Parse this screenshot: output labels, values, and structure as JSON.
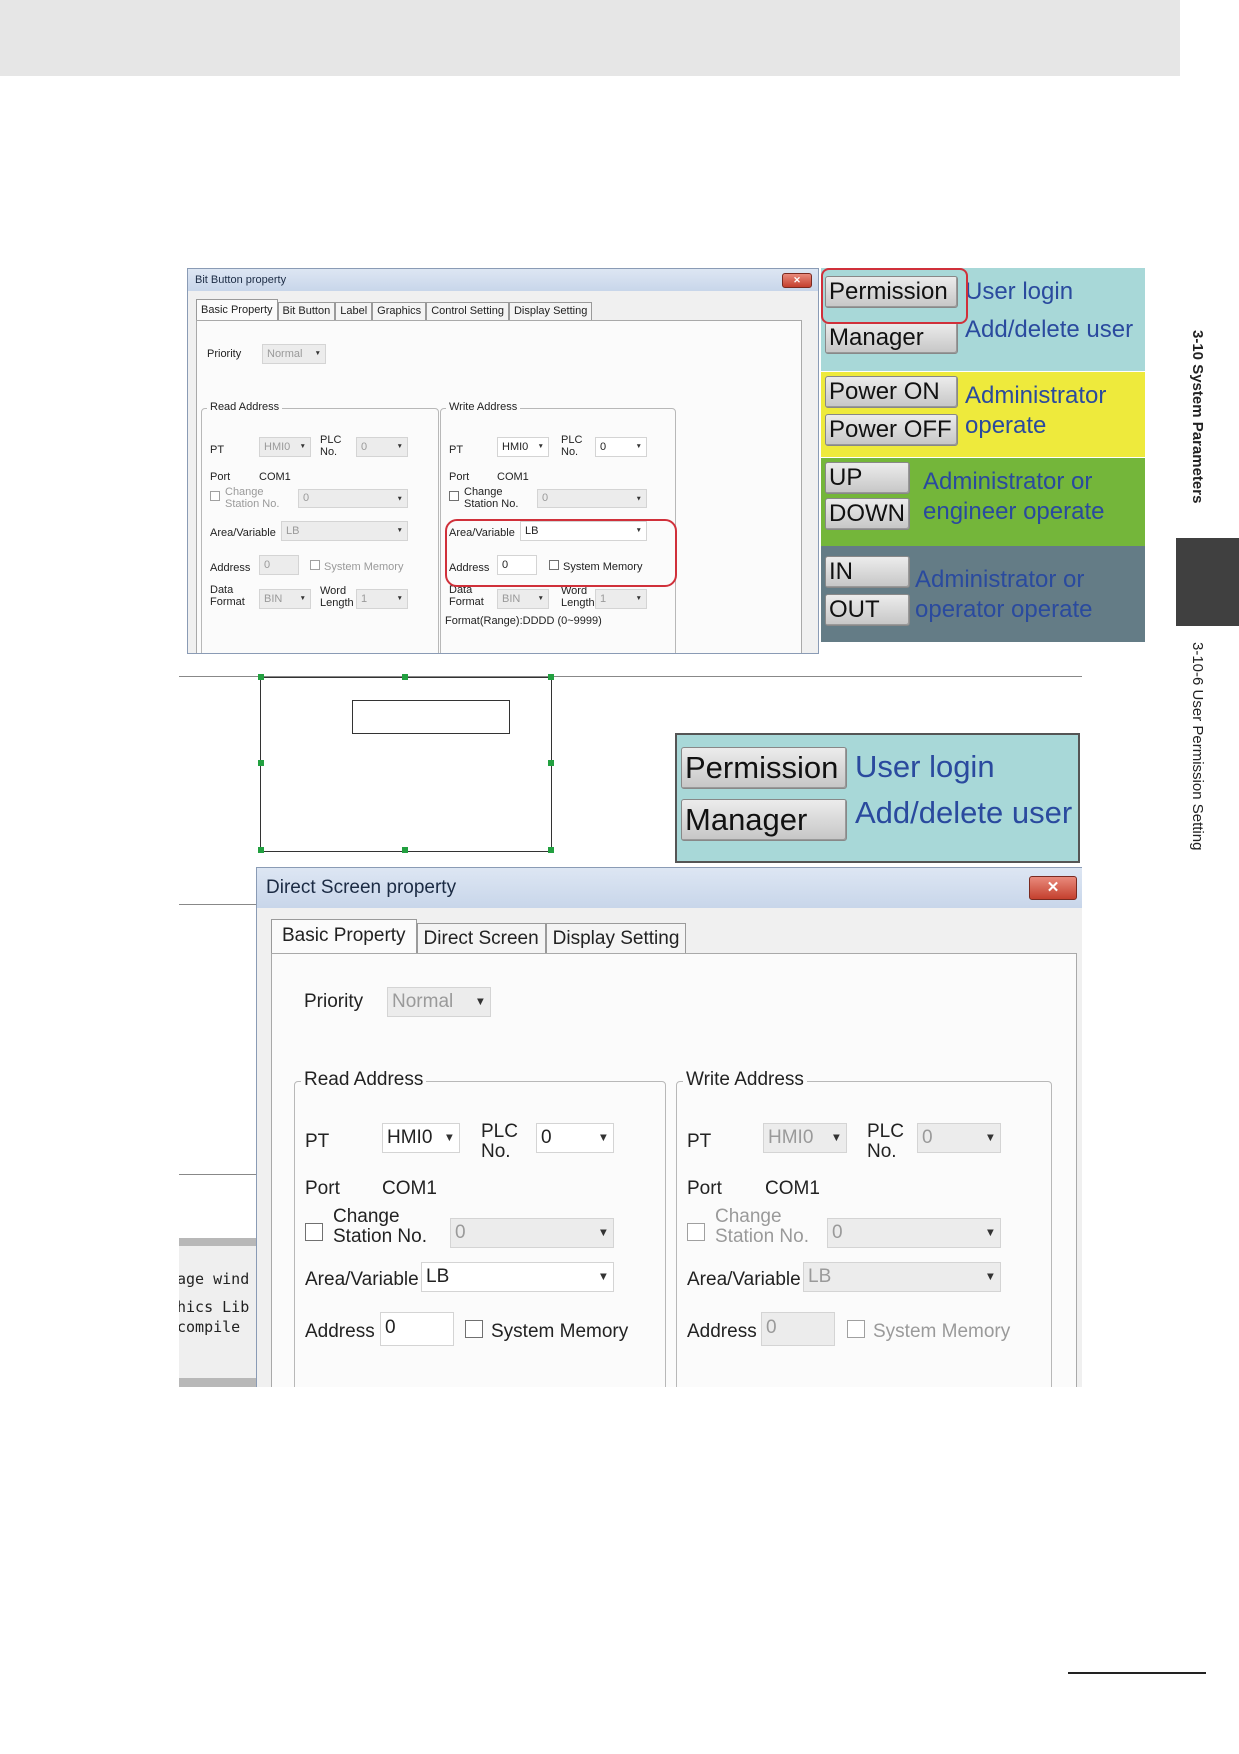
{
  "chapter_tab": "3-10 System Parameters",
  "section_tab": "3-10-6 User Permission Setting",
  "bit_button_dialog": {
    "title": "Bit Button property",
    "close": "✕",
    "tabs": [
      "Basic Property",
      "Bit Button",
      "Label",
      "Graphics",
      "Control Setting",
      "Display Setting"
    ],
    "priority_label": "Priority",
    "priority_value": "Normal",
    "read": {
      "title": "Read Address",
      "pt_label": "PT",
      "pt_value": "HMI0",
      "plc_label_1": "PLC",
      "plc_label_2": "No.",
      "plc_value": "0",
      "port_label": "Port",
      "port_value": "COM1",
      "change_1": "Change",
      "change_2": "Station No.",
      "change_value": "0",
      "area_label": "Area/Variable",
      "area_value": "LB",
      "address_label": "Address",
      "address_value": "0",
      "sysmem_label": "System Memory",
      "data_1": "Data",
      "data_2": "Format",
      "data_value": "BIN",
      "word_1": "Word",
      "word_2": "Length",
      "word_value": "1"
    },
    "write": {
      "title": "Write Address",
      "pt_label": "PT",
      "pt_value": "HMI0",
      "plc_label_1": "PLC",
      "plc_label_2": "No.",
      "plc_value": "0",
      "port_label": "Port",
      "port_value": "COM1",
      "change_1": "Change",
      "change_2": "Station No.",
      "change_value": "0",
      "area_label": "Area/Variable",
      "area_value": "LB",
      "address_label": "Address",
      "address_value": "0",
      "sysmem_label": "System Memory",
      "data_1": "Data",
      "data_2": "Format",
      "data_value": "BIN",
      "word_1": "Word",
      "word_2": "Length",
      "word_value": "1",
      "format_range": "Format(Range):DDDD (0~9999)"
    }
  },
  "permission_panel": {
    "group1": {
      "btn1": "Permission",
      "btn2": "Manager",
      "text1": "User login",
      "text2": "Add/delete user"
    },
    "group2": {
      "btn1": "Power ON",
      "btn2": "Power OFF",
      "text1": "Administrator",
      "text2": "operate"
    },
    "group3": {
      "btn1": "UP",
      "btn2": "DOWN",
      "text1": "Administrator or",
      "text2": "engineer operate"
    },
    "group4": {
      "btn1": "IN",
      "btn2": "OUT",
      "text1": "Administrator or",
      "text2": "operator operate"
    },
    "colors": {
      "g1": "#a8d8d8",
      "g2": "#eeea3c",
      "g3": "#74b63a",
      "g4": "#647c86"
    }
  },
  "permission_panel_2": {
    "btn1": "Permission",
    "btn2": "Manager",
    "text1": "User login",
    "text2": "Add/delete user"
  },
  "background_fragments": {
    "line1": "age wind",
    "line2": "hics Lib",
    "line3": "compile"
  },
  "direct_screen_dialog": {
    "title": "Direct Screen property",
    "close": "✕",
    "tabs": [
      "Basic Property",
      "Direct Screen",
      "Display Setting"
    ],
    "priority_label": "Priority",
    "priority_value": "Normal",
    "read": {
      "title": "Read Address",
      "pt_label": "PT",
      "pt_value": "HMI0",
      "plc_label_1": "PLC",
      "plc_label_2": "No.",
      "plc_value": "0",
      "port_label": "Port",
      "port_value": "COM1",
      "change_1": "Change",
      "change_2": "Station No.",
      "change_value": "0",
      "area_label": "Area/Variable",
      "area_value": "LB",
      "address_label": "Address",
      "address_value": "0",
      "sysmem_label": "System Memory"
    },
    "write": {
      "title": "Write Address",
      "pt_label": "PT",
      "pt_value": "HMI0",
      "plc_label_1": "PLC",
      "plc_label_2": "No.",
      "plc_value": "0",
      "port_label": "Port",
      "port_value": "COM1",
      "change_1": "Change",
      "change_2": "Station No.",
      "change_value": "0",
      "area_label": "Area/Variable",
      "area_value": "LB",
      "address_label": "Address",
      "address_value": "0",
      "sysmem_label": "System Memory"
    }
  }
}
